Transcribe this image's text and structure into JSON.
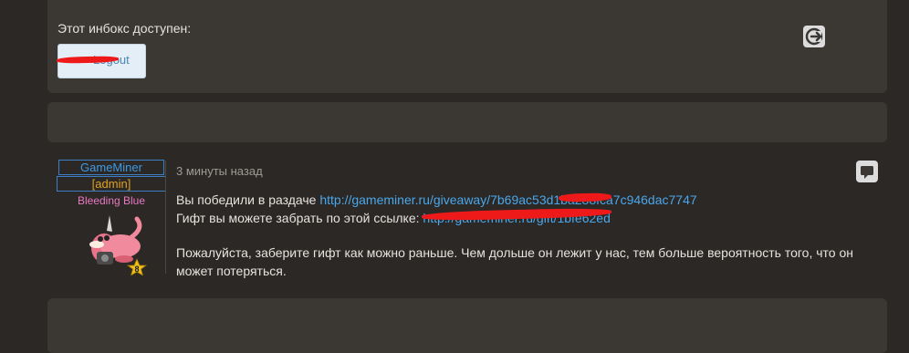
{
  "inbox": {
    "text": "Этот инбокс доступен:",
    "button_label": "Logout"
  },
  "message": {
    "username": "GameMiner",
    "role": "[admin]",
    "game": "Bleeding Blue",
    "level": "8",
    "time": "3 минуты назад",
    "line1_prefix": "Вы победили в раздаче ",
    "giveaway_link": "http://gameminer.ru/giveaway/7b69ac53d1ba288fca7c946dac7747",
    "line2_prefix": "Гифт вы можете забрать по этой ссылке: ",
    "gift_link": "http://gameminer.ru/gift/1bfe62ed",
    "paragraph": "Пожалуйста, заберите гифт как можно раньше. Чем дольше он лежит у нас, тем больше вероятность того, что он может потеряться."
  },
  "icons": {
    "exit": "exit-arrow-icon",
    "reply": "speech-bubble-icon"
  },
  "colors": {
    "background": "#2b2826",
    "panel": "#3b3834",
    "link": "#4aa7ea",
    "redaction": "#ee1a1a"
  }
}
